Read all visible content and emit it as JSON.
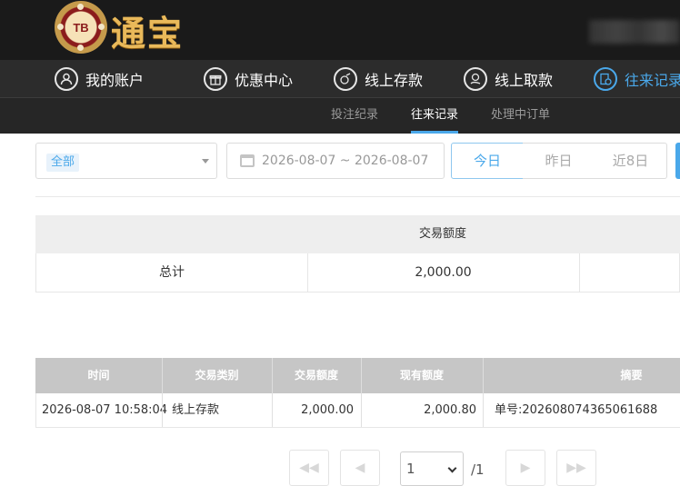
{
  "brand": {
    "chip_text": "TB",
    "logo_text": "通宝"
  },
  "mainnav": {
    "items": [
      {
        "label": "我的账户",
        "icon": "user-icon"
      },
      {
        "label": "优惠中心",
        "icon": "gift-icon"
      },
      {
        "label": "线上存款",
        "icon": "deposit-icon"
      },
      {
        "label": "线上取款",
        "icon": "withdraw-icon"
      },
      {
        "label": "往来记录",
        "icon": "records-icon",
        "active": true
      }
    ]
  },
  "subnav": {
    "items": [
      {
        "label": "投注纪录"
      },
      {
        "label": "往来记录",
        "active": true
      },
      {
        "label": "处理中订单"
      }
    ]
  },
  "filters": {
    "type_select": {
      "selected": "全部"
    },
    "date_range": "2026-08-07 ~ 2026-08-07",
    "quick_dates": [
      "今日",
      "昨日",
      "近8日"
    ],
    "quick_active": "今日"
  },
  "summary": {
    "header": "交易额度",
    "total_label": "总计",
    "total_value": "2,000.00"
  },
  "records": {
    "columns": [
      "时间",
      "交易类别",
      "交易额度",
      "现有额度",
      "摘要"
    ],
    "rows": [
      [
        "2026-08-07 10:58:04",
        "线上存款",
        "2,000.00",
        "2,000.80",
        "单号:202608074365061688"
      ]
    ]
  },
  "pagination": {
    "current": "1",
    "total": "/1"
  },
  "colors": {
    "accent": "#4aa8ea",
    "gold": "#e9b95a",
    "dark": "#1a1a1a"
  }
}
